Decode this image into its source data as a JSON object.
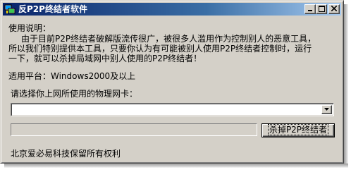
{
  "window": {
    "title": "反P2P终结者软件",
    "controls": {
      "minimize": "_",
      "maximize": "□",
      "close": "×"
    }
  },
  "instructions": {
    "heading": "使用说明：",
    "line1": "由于目前P2P终结者破解版流传很广，被很多人滥用作为控制别人的恶意工具，",
    "line2": "所以我们特别提供本工具，只要你认为有可能被别人使用P2P终结者控制时，运行",
    "line3": "一下，就可以杀掉局域网中别人使用的P2P终结者！"
  },
  "platform": {
    "text": "适用平台：Windows2000及以上"
  },
  "nic": {
    "prompt": "请选择你上网所使用的物理网卡：",
    "selected_value": ""
  },
  "progress": {
    "value": 0
  },
  "actions": {
    "kill_label": "杀掉P2P终结者"
  },
  "footer": {
    "copyright": "北京爱必易科技保留所有权利"
  },
  "colors": {
    "face": "#d4d0c8",
    "titlebar_start": "#0a246a",
    "titlebar_end": "#a6caf0"
  }
}
